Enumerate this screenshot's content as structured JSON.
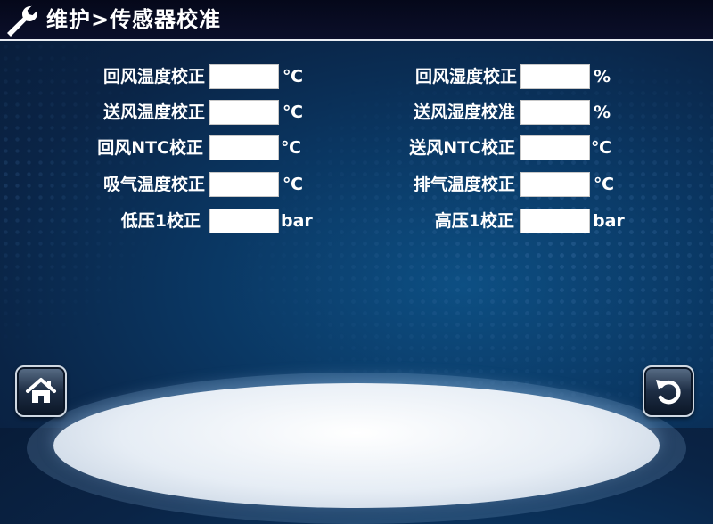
{
  "header": {
    "title": "维护>传感器校准",
    "icon": "wrench-icon"
  },
  "left_rows": [
    {
      "label": "回风温度校正",
      "value": "",
      "unit": "℃"
    },
    {
      "label": "送风温度校正",
      "value": "",
      "unit": "℃"
    },
    {
      "label": "回风NTC校正",
      "value": "",
      "unit": "℃"
    },
    {
      "label": "吸气温度校正",
      "value": "",
      "unit": "℃"
    },
    {
      "label": "低压1校正",
      "value": "",
      "unit": "bar"
    }
  ],
  "right_rows": [
    {
      "label": "回风湿度校正",
      "value": "",
      "unit": "%"
    },
    {
      "label": "送风湿度校准",
      "value": "",
      "unit": "%"
    },
    {
      "label": "送风NTC校正",
      "value": "",
      "unit": "℃"
    },
    {
      "label": "排气温度校正",
      "value": "",
      "unit": "℃"
    },
    {
      "label": "高压1校正",
      "value": "",
      "unit": "bar"
    }
  ],
  "nav": {
    "home_icon": "home-icon",
    "back_icon": "back-arrow-icon"
  },
  "colors": {
    "background": "#0a2446",
    "header": "#05081a",
    "text": "#ffffff"
  }
}
